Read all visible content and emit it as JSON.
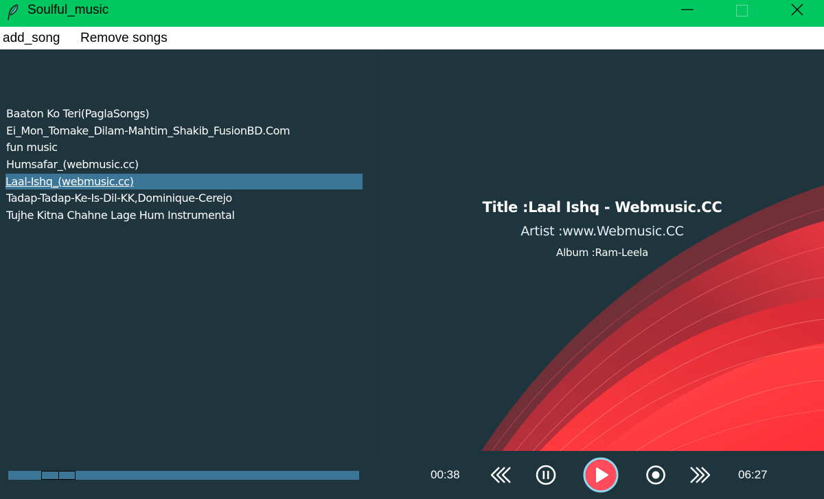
{
  "window": {
    "title": "Soulful_music",
    "icon": "feather-icon",
    "accent_color": "#00c75f"
  },
  "menu": {
    "add_label": "add_song",
    "remove_label": "Remove songs"
  },
  "playlist": {
    "songs": [
      "Baaton Ko Teri(PaglaSongs)",
      "Ei_Mon_Tomake_Dilam-Mahtim_Shakib_FusionBD.Com",
      " fun music",
      "Humsafar_(webmusic.cc)",
      "Laal-Ishq_(webmusic.cc)",
      "Tadap-Tadap-Ke-Is-Dil-KK,Dominique-Cerejo",
      "Tujhe Kitna Chahne Lage Hum Instrumental"
    ],
    "selected_index": 4,
    "selected_color": "#3b7698"
  },
  "now_playing": {
    "title": "Title :Laal Ishq - Webmusic.CC",
    "artist": "Artist :www.Webmusic.CC",
    "album": "Album :Ram-Leela"
  },
  "player": {
    "current_time": "00:38",
    "total_time": "06:27",
    "progress": 0.1,
    "icons": [
      "rewind-icon",
      "pause-icon",
      "play-icon",
      "stop-icon",
      "fast-forward-icon"
    ]
  }
}
